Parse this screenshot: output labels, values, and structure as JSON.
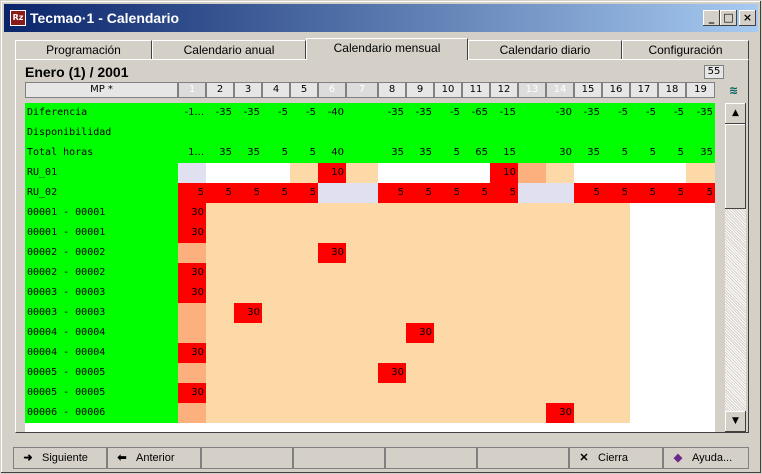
{
  "window": {
    "title": "Tecmao·1 - Calendario",
    "icon_label": "Rz",
    "controls": [
      "_",
      "□",
      "×"
    ]
  },
  "tabs": [
    {
      "label": "Programación"
    },
    {
      "label": "Calendario anual"
    },
    {
      "label": "Calendario mensual",
      "active": true
    },
    {
      "label": "Calendario diario"
    },
    {
      "label": "Configuración"
    }
  ],
  "month_label": "Enero (1) / 2001",
  "count": "55",
  "header": {
    "mp_label": "MP *",
    "days": [
      "1",
      "2",
      "3",
      "4",
      "5",
      "6",
      "7",
      "8",
      "9",
      "10",
      "11",
      "12",
      "13",
      "14",
      "15",
      "16",
      "17",
      "18",
      "19"
    ],
    "off_days": [
      "1",
      "6",
      "7",
      "13",
      "14"
    ]
  },
  "rows": [
    {
      "label": "Diferencia",
      "cells": [
        "-1...",
        "-35",
        "-35",
        "-5",
        "-5",
        "-40",
        "",
        "-35",
        "-35",
        "-5",
        "-65",
        "-15",
        "",
        "-30",
        "-35",
        "-5",
        "-5",
        "-5",
        "-35"
      ]
    },
    {
      "label": "Disponibilidad",
      "cells": []
    },
    {
      "label": "Total horas",
      "cells": [
        "1...",
        "35",
        "35",
        "5",
        "5",
        "40",
        "",
        "35",
        "35",
        "5",
        "65",
        "15",
        "",
        "30",
        "35",
        "5",
        "5",
        "5",
        "35"
      ]
    },
    {
      "label": "RU_01",
      "cells": [
        "",
        "",
        "",
        "",
        "",
        "10",
        "",
        "",
        "",
        "",
        "",
        "10",
        "",
        "",
        "",
        "",
        "",
        "",
        ""
      ]
    },
    {
      "label": "RU_02",
      "cells": [
        "5",
        "5",
        "5",
        "5",
        "5",
        "",
        "",
        "5",
        "5",
        "5",
        "5",
        "5",
        "",
        "",
        "5",
        "5",
        "5",
        "5",
        "5"
      ]
    },
    {
      "label": "00001 - 00001",
      "cells": [
        "30"
      ]
    },
    {
      "label": "00001 - 00001",
      "cells": [
        "30"
      ]
    },
    {
      "label": "00002 - 00002",
      "cells": [
        "",
        "",
        "",
        "",
        "",
        "30"
      ]
    },
    {
      "label": "00002 - 00002",
      "cells": [
        "30"
      ]
    },
    {
      "label": "00003 - 00003",
      "cells": [
        "30"
      ]
    },
    {
      "label": "00003 - 00003",
      "cells": [
        "",
        "",
        "30"
      ]
    },
    {
      "label": "00004 - 00004",
      "cells": [
        "",
        "",
        "",
        "",
        "",
        "",
        "",
        "",
        "30"
      ]
    },
    {
      "label": "00004 - 00004",
      "cells": [
        "30"
      ]
    },
    {
      "label": "00005 - 00005",
      "cells": [
        "",
        "",
        "",
        "",
        "",
        "",
        "",
        "30"
      ]
    },
    {
      "label": "00005 - 00005",
      "cells": [
        "30"
      ]
    },
    {
      "label": "00006 - 00006",
      "cells": [
        "",
        "",
        "",
        "",
        "",
        "",
        "",
        "",
        "",
        "",
        "",
        "",
        "",
        "30"
      ]
    }
  ],
  "footer": {
    "next_label": "Siguiente",
    "prev_label": "Anterior",
    "close_label": "Cierra",
    "help_label": "Ayuda..."
  },
  "colors": {
    "label_bg": "#00ff00",
    "red": "#ff0000",
    "peach": "#fdd9a8",
    "orange": "#fbb07d",
    "lilac": "#e0e0f0"
  }
}
